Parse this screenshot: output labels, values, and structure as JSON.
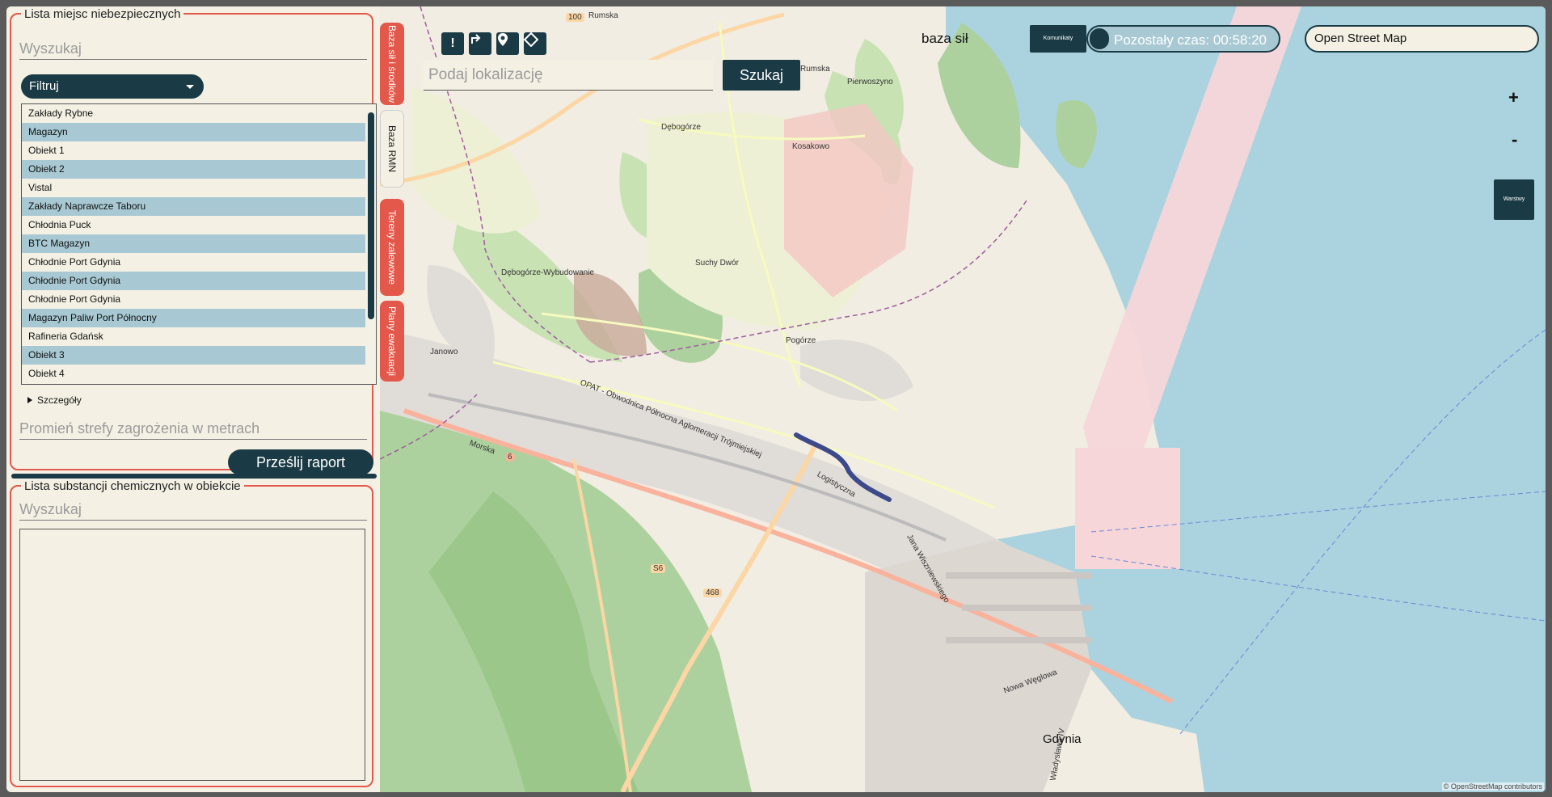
{
  "left_panel": {
    "places_group": {
      "legend": "Lista miejsc niebezpiecznych",
      "search_placeholder": "Wyszukaj",
      "filter_label": "Filtruj",
      "items": [
        "Zakłady Rybne",
        "Magazyn",
        "Obiekt 1",
        "Obiekt 2",
        "Vistal",
        "Zakłady Naprawcze Taboru",
        "Chłodnia Puck",
        "BTC Magazyn",
        "Chłodnie Port Gdynia",
        "Chłodnie Port Gdynia",
        "Chłodnie Port Gdynia",
        "Magazyn Paliw Port Północny",
        "Rafineria Gdańsk",
        "Obiekt 3",
        "Obiekt 4"
      ],
      "details_label": "Szczegóły",
      "radius_placeholder": "Promień strefy zagrożenia w metrach",
      "send_label": "Prześlij raport"
    },
    "chemicals_group": {
      "legend": "Lista substancji chemicznych w obiekcie",
      "search_placeholder": "Wyszukaj"
    }
  },
  "vertical_tabs": [
    "Baza sił i środków",
    "Baza RMN",
    "Tereny zalewowe",
    "Plany ewakuacji"
  ],
  "map": {
    "toolbar_icons": [
      "alert-icon",
      "turn-right-icon",
      "map-pin-icon",
      "diamond-icon"
    ],
    "location_placeholder": "Podaj lokalizację",
    "search_label": "Szukaj",
    "layer_title": "baza sił",
    "communications_label": "Komunikaty",
    "timer_text": "Pozostały czas: 00:58:20",
    "basemap_value": "Open Street Map",
    "zoom_in": "+",
    "zoom_out": "-",
    "layers_label": "Warstwy",
    "attribution": "© OpenStreetMap contributors",
    "labels": {
      "rumska": "Rumska",
      "rumska2": "Rumska",
      "pierwoszyno": "Pierwoszyno",
      "debogorze": "Dębogórze",
      "kosakowo": "Kosakowo",
      "suchy_dwor": "Suchy Dwór",
      "debogorze_wyb": "Dębogórze-Wybudowanie",
      "pogorze": "Pogórze",
      "janowo": "Janowo",
      "opat": "OPAT - Obwodnica Północna Aglomeracji Trójmiejskiej",
      "logistyczna": "Logistyczna",
      "morska": "Morska",
      "nowa_weglowa": "Nowa Węglowa",
      "gdynia": "Gdynia",
      "wladyslawa": "Władysława IV",
      "jana_wiszniewskiego": "Jana Wiszniewskiego",
      "road_100": "100",
      "road_468": "468",
      "road_6": "6",
      "road_s6": "S6"
    }
  }
}
